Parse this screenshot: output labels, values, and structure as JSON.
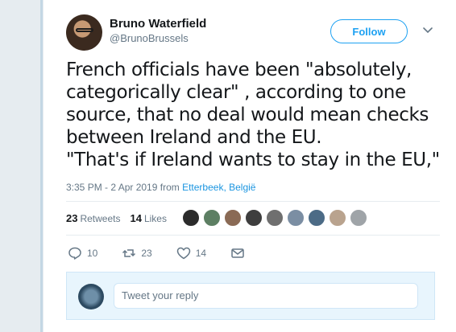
{
  "author": {
    "name": "Bruno Waterfield",
    "handle": "@BrunoBrussels"
  },
  "follow_label": "Follow",
  "tweet": {
    "text": "French officials have been \"absolutely, categorically clear\" , according to one source,  that no deal would mean checks between Ireland and the EU.\n\"That's if Ireland wants to stay in the EU,\"",
    "timestamp": "3:35 PM - 2 Apr 2019 from ",
    "location": "Etterbeek, België"
  },
  "stats": {
    "retweets_count": "23",
    "retweets_label": "Retweets",
    "likes_count": "14",
    "likes_label": "Likes"
  },
  "actions": {
    "reply_count": "10",
    "retweet_count": "23",
    "like_count": "14"
  },
  "reply": {
    "placeholder": "Tweet your reply"
  },
  "colors": {
    "accent": "#1da1f2",
    "link": "#1b95e0",
    "muted": "#657786"
  }
}
